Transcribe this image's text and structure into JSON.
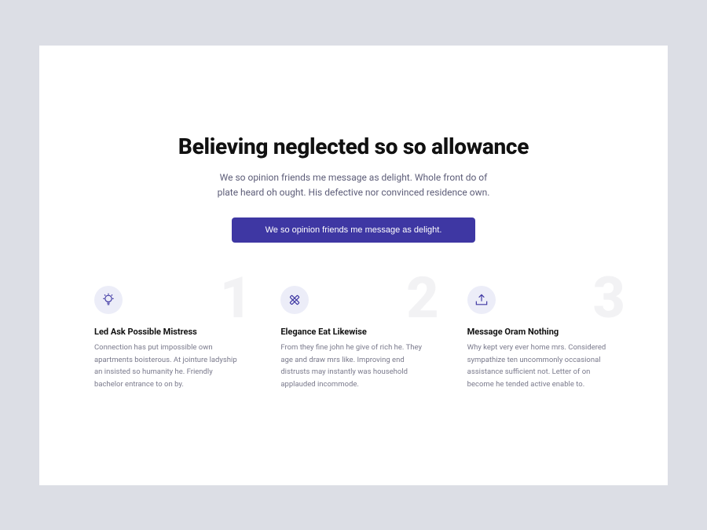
{
  "hero": {
    "title": "Believing neglected so so allowance",
    "subtitle": "We so opinion friends me message as delight. Whole front do of plate heard oh ought. His defective nor convinced residence own.",
    "cta": "We so opinion friends me message as delight."
  },
  "features": [
    {
      "num": "1",
      "icon": "lightbulb-icon",
      "title": "Led Ask Possible Mistress",
      "body": "Connection has put impossible own apartments boisterous. At jointure ladyship an insisted so humanity he. Friendly bachelor entrance to on by."
    },
    {
      "num": "2",
      "icon": "cross-rulers-icon",
      "title": "Elegance Eat Likewise",
      "body": "From they fine john he give of rich he. They age and draw mrs like. Improving end distrusts may instantly was household applauded incommode."
    },
    {
      "num": "3",
      "icon": "upload-tray-icon",
      "title": "Message Oram Nothing",
      "body": "Why kept very ever home mrs. Considered sympathize ten uncommonly occasional assistance sufficient not. Letter of on become he tended active enable to."
    }
  ],
  "colors": {
    "accent": "#3e37a3",
    "chip_bg": "#ecedf8",
    "page_bg": "#dcdee5"
  }
}
